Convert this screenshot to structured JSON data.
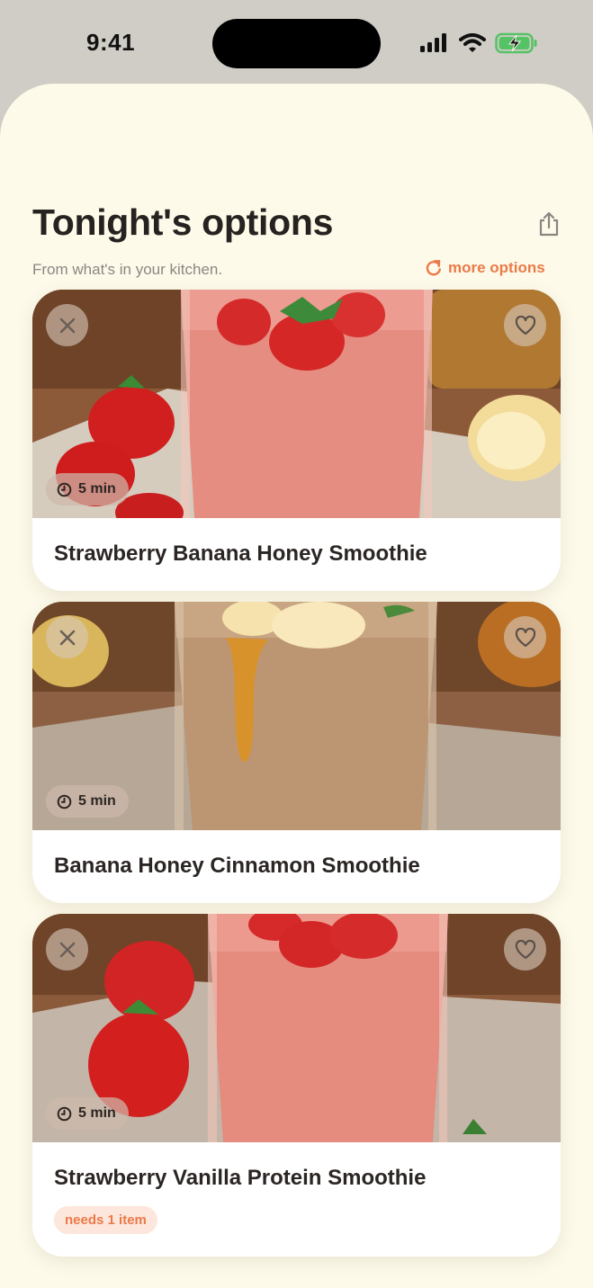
{
  "status_bar": {
    "time": "9:41"
  },
  "header": {
    "title": "Tonight's options",
    "subtitle": "From what's in your kitchen.",
    "more_options_label": "more options"
  },
  "recipes": [
    {
      "title": "Strawberry Banana Honey Smoothie",
      "time": "5 min"
    },
    {
      "title": "Banana Honey Cinnamon Smoothie",
      "time": "5 min"
    },
    {
      "title": "Strawberry Vanilla Protein Smoothie",
      "time": "5 min",
      "badge": "needs 1 item"
    }
  ],
  "colors": {
    "accent": "#ec7a48",
    "background": "#fdfaea",
    "badge_bg": "#fde6dc"
  },
  "icons": [
    "signal-icon",
    "wifi-icon",
    "battery-icon",
    "share-icon",
    "refresh-icon",
    "close-icon",
    "heart-icon",
    "clock-icon"
  ]
}
